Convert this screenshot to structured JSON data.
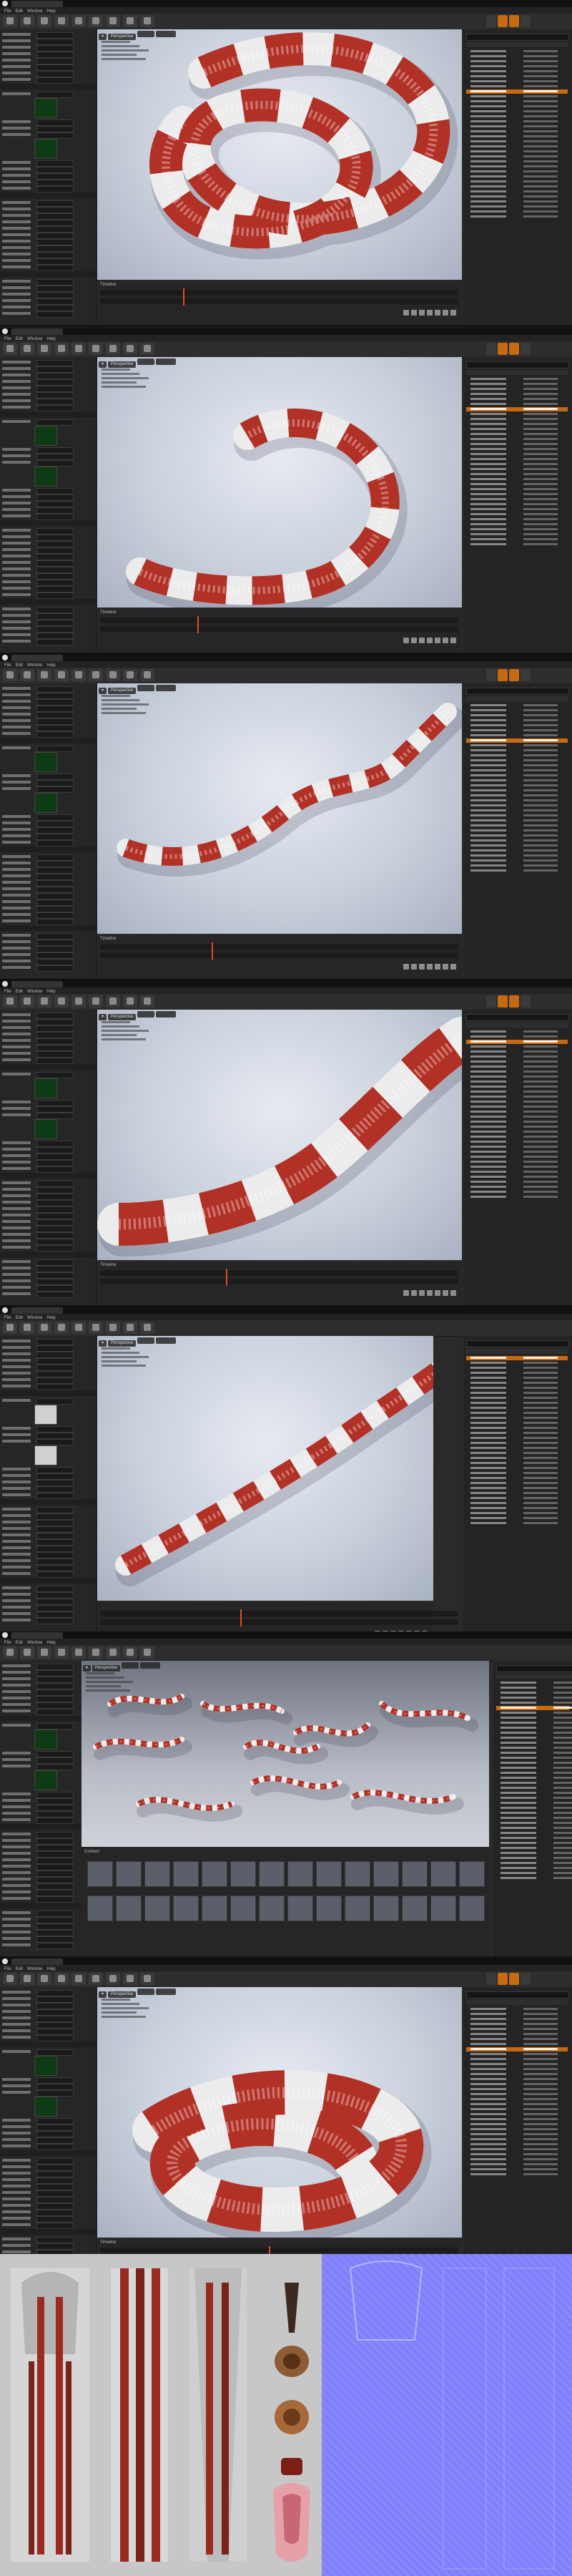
{
  "screenshots": [
    {
      "id": "shot1",
      "menu": [
        "File",
        "Edit",
        "Window",
        "Help"
      ],
      "viewport_button": "Perspective",
      "timeline_label": "Timeline"
    },
    {
      "id": "shot2",
      "menu": [
        "File",
        "Edit",
        "Window",
        "Help"
      ],
      "viewport_button": "Perspective",
      "timeline_label": "Timeline"
    },
    {
      "id": "shot3",
      "menu": [
        "File",
        "Edit",
        "Window",
        "Help"
      ],
      "viewport_button": "Perspective",
      "timeline_label": "Timeline"
    },
    {
      "id": "shot4",
      "menu": [
        "File",
        "Edit",
        "Window",
        "Help"
      ],
      "viewport_button": "Perspective",
      "timeline_label": "Timeline"
    },
    {
      "id": "shot5",
      "menu": [
        "File",
        "Edit",
        "Window",
        "Help"
      ],
      "viewport_button": "Perspective",
      "timeline_label": ""
    },
    {
      "id": "shot6",
      "menu": [
        "File",
        "Edit",
        "Window",
        "Help"
      ],
      "viewport_button": "Perspective",
      "timeline_label": "Content"
    },
    {
      "id": "shot7",
      "menu": [
        "File",
        "Edit",
        "Window",
        "Help"
      ],
      "viewport_button": "Perspective",
      "timeline_label": "Timeline"
    }
  ],
  "colors": {
    "ui_dark": "#2a2a2a",
    "accent_orange": "#c36a12",
    "snake_red": "#b23126",
    "snake_white": "#ececec",
    "normal_map": "#8080ff"
  },
  "icons": [
    "unreal-logo-icon",
    "save-icon",
    "play-icon",
    "settings-icon",
    "search-icon"
  ]
}
